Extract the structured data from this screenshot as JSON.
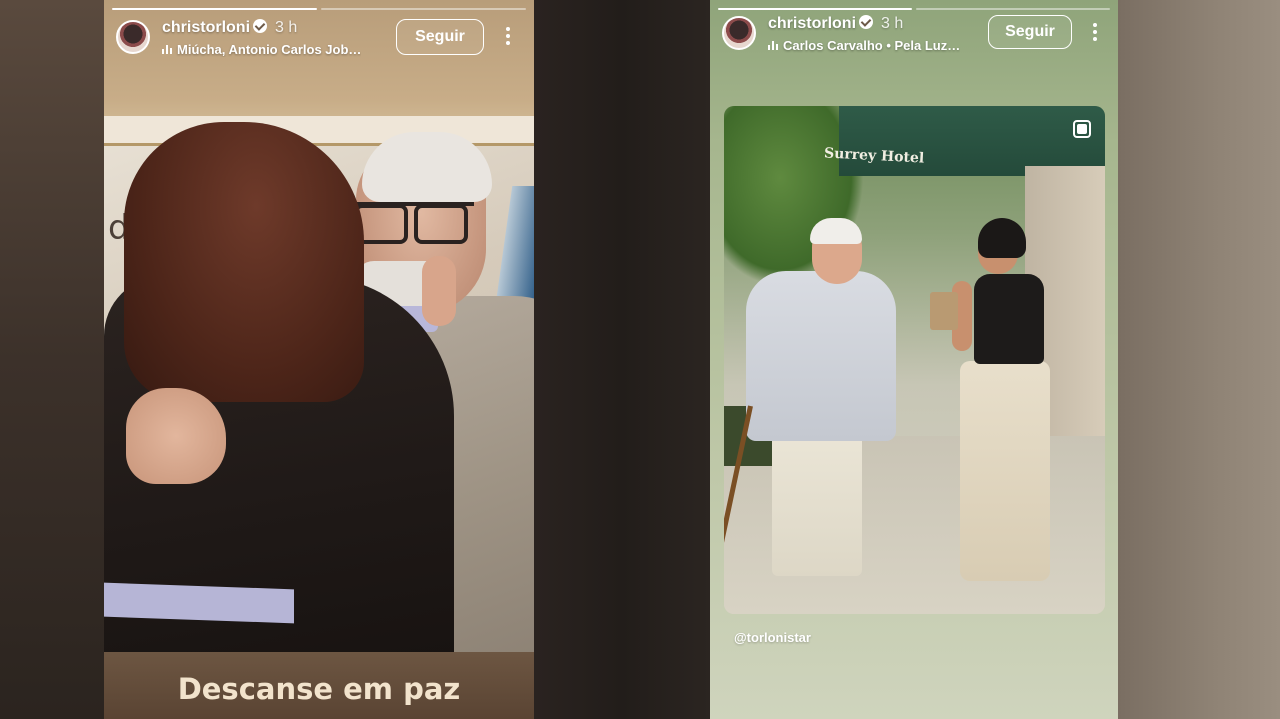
{
  "stories": [
    {
      "username": "christorloni",
      "time": "3 h",
      "music": "Miúcha, Antonio Carlos Job…",
      "follow_label": "Seguir",
      "caption": "Descanse em paz",
      "progress": [
        1,
        0
      ]
    },
    {
      "username": "christorloni",
      "time": "3 h",
      "music": "Carlos Carvalho • Pela Luz…",
      "follow_label": "Seguir",
      "mention": "@torlonistar",
      "photo_sign": "Surrey Hotel",
      "progress": [
        1,
        0
      ]
    }
  ],
  "photo1_store_text": "dres",
  "icons": [
    "verified-icon",
    "music-icon",
    "more-options-icon",
    "multi-photo-icon"
  ],
  "colors": {
    "story1_bg": "#c8ad88",
    "story2_bg": "#a6b68e",
    "caption_text": "#f2e3cc"
  }
}
